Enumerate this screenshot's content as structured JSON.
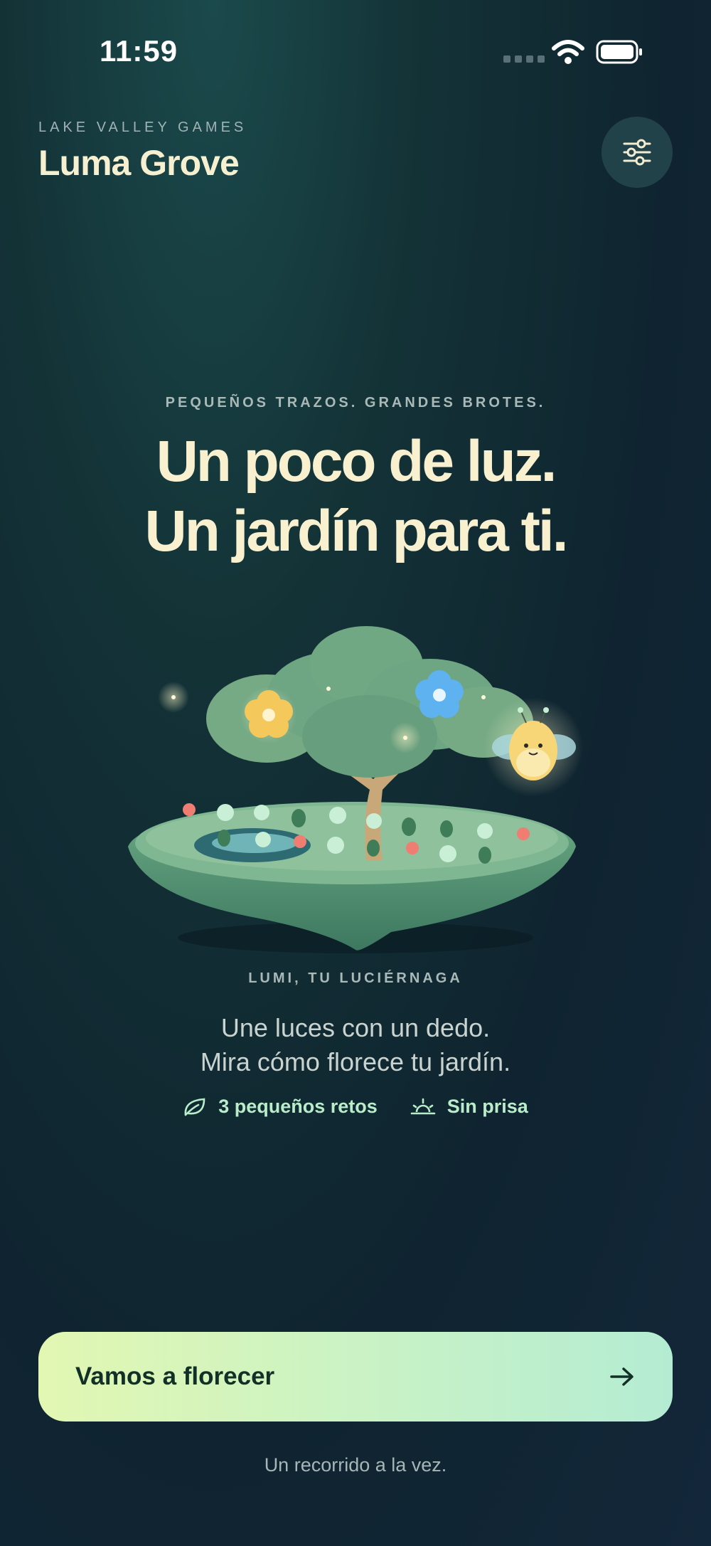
{
  "status_bar": {
    "time": "11:59"
  },
  "header": {
    "studio": "LAKE VALLEY GAMES",
    "title": "Luma Grove",
    "settings_icon": "sliders-icon"
  },
  "hero": {
    "tagline": "PEQUEÑOS TRAZOS. GRANDES BROTES.",
    "headline_line1": "Un poco de luz.",
    "headline_line2": "Un jardín para ti."
  },
  "companion": {
    "caption": "LUMI, TU LUCIÉRNAGA",
    "description_line1": "Une luces con un dedo.",
    "description_line2": "Mira cómo florece tu jardín."
  },
  "meta": [
    {
      "icon": "leaf-icon",
      "label": "3 pequeños retos"
    },
    {
      "icon": "sunrise-icon",
      "label": "Sin prisa"
    }
  ],
  "cta": {
    "label": "Vamos a florecer",
    "icon": "arrow-right-icon"
  },
  "footer": {
    "note": "Un recorrido a la vez."
  },
  "colors": {
    "background": "#133236",
    "headline": "#f8f0cf",
    "accent_green": "#b9ecc9",
    "cta_start": "#e2f7b2",
    "cta_end": "#b4ecd3"
  }
}
